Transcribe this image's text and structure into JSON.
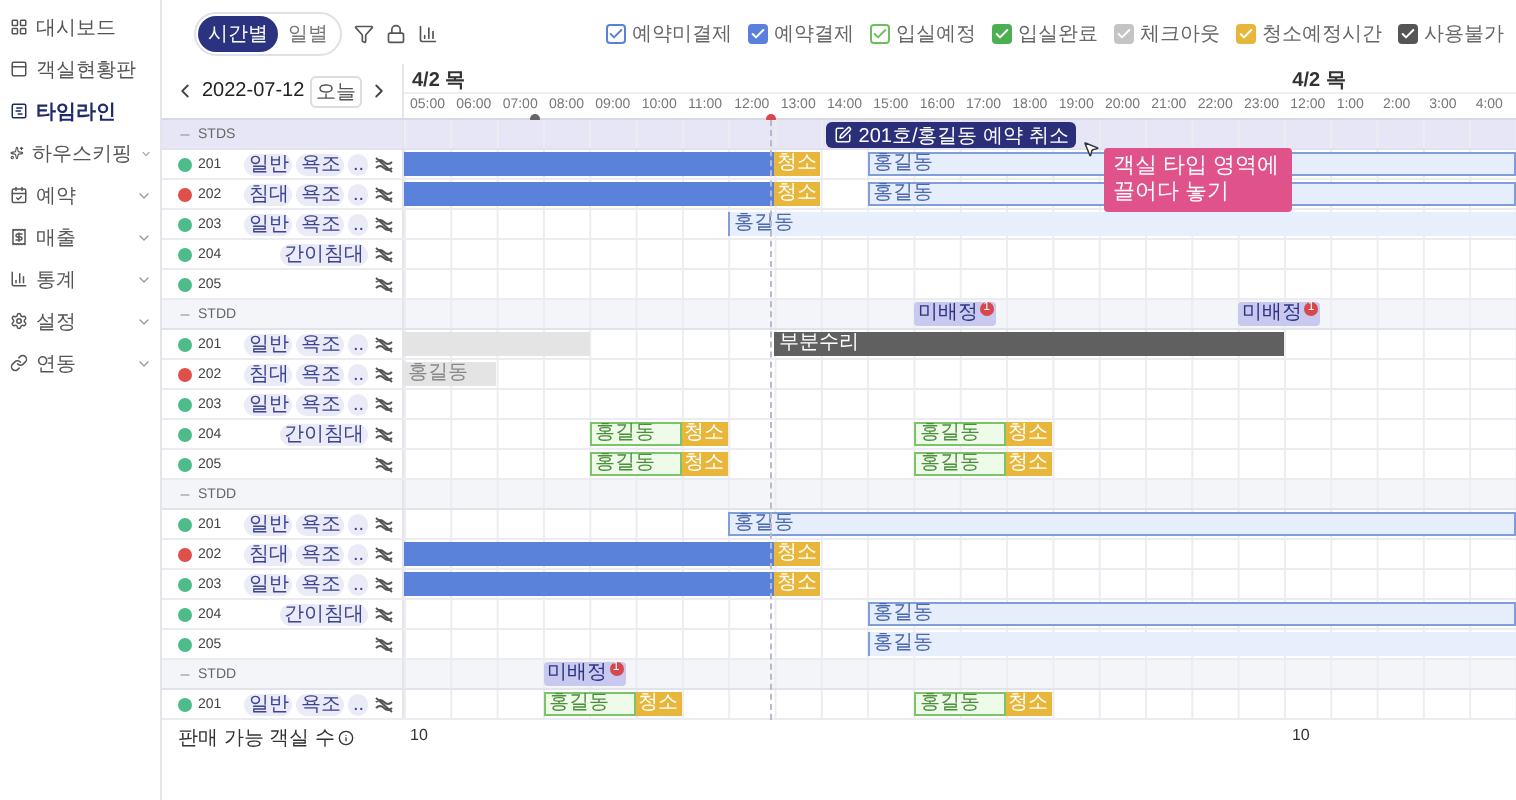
{
  "sidebar": {
    "items": [
      {
        "label": "대시보드",
        "selected": false,
        "expandable": false
      },
      {
        "label": "객실현황판",
        "selected": false,
        "expandable": false
      },
      {
        "label": "타임라인",
        "selected": true,
        "expandable": false
      },
      {
        "label": "하우스키핑",
        "selected": false,
        "expandable": true
      },
      {
        "label": "예약",
        "selected": false,
        "expandable": true
      },
      {
        "label": "매출",
        "selected": false,
        "expandable": true
      },
      {
        "label": "통계",
        "selected": false,
        "expandable": true
      },
      {
        "label": "설정",
        "selected": false,
        "expandable": true
      },
      {
        "label": "연동",
        "selected": false,
        "expandable": true
      }
    ]
  },
  "view_toggle": [
    {
      "label": "시간별",
      "selected": true
    },
    {
      "label": "일별",
      "selected": false
    }
  ],
  "legend": [
    {
      "label": "예약미결제",
      "color": "#5b7fdc",
      "kind": "outline",
      "checked": true
    },
    {
      "label": "예약결제",
      "color": "#5b7fdc",
      "kind": "solid",
      "checked": true
    },
    {
      "label": "입실예정",
      "color": "#6cbf5a",
      "kind": "outline",
      "checked": true
    },
    {
      "label": "입실완료",
      "color": "#4caf50",
      "kind": "solid",
      "checked": true
    },
    {
      "label": "체크아웃",
      "color": "#c4c4c4",
      "kind": "solid",
      "checked": true
    },
    {
      "label": "청소예정시간",
      "color": "#e8b63a",
      "kind": "solid",
      "checked": true
    },
    {
      "label": "사용불가",
      "color": "#555555",
      "kind": "solid",
      "checked": true
    }
  ],
  "date_nav": {
    "date": "2022-07-12",
    "today_button": "오늘"
  },
  "timeline": {
    "days": [
      "4/2 목",
      "4/2 목"
    ],
    "hours": [
      "05:00",
      "06:00",
      "07:00",
      "08:00",
      "09:00",
      "10:00",
      "11:00",
      "12:00",
      "13:00",
      "14:00",
      "15:00",
      "16:00",
      "17:00",
      "18:00",
      "19:00",
      "20:00",
      "21:00",
      "22:00",
      "23:00",
      "12:00",
      "1:00",
      "2:00",
      "3:00",
      "4:00"
    ]
  },
  "groups": [
    {
      "name": "STDS",
      "highlighted": true,
      "rooms": [
        {
          "number": "201",
          "color": "#4dbb8a",
          "tags": [
            "일반",
            "욕조",
            ".."
          ],
          "bars": [
            {
              "kind": "paid"
            },
            {
              "kind": "cleaning",
              "label": "청소"
            },
            {
              "kind": "unpaid",
              "label": "홍길동"
            }
          ]
        },
        {
          "number": "202",
          "color": "#e0504a",
          "tags": [
            "침대",
            "욕조",
            ".."
          ],
          "bars": [
            {
              "kind": "paid"
            },
            {
              "kind": "cleaning",
              "label": "청소"
            },
            {
              "kind": "unpaid",
              "label": "홍길동"
            }
          ]
        },
        {
          "number": "203",
          "color": "#4dbb8a",
          "tags": [
            "일반",
            "욕조",
            ".."
          ],
          "bars": [
            {
              "kind": "pending",
              "label": "홍길동"
            }
          ]
        },
        {
          "number": "204",
          "color": "#4dbb8a",
          "tags": [
            "간이침대"
          ]
        },
        {
          "number": "205",
          "color": "#4dbb8a"
        }
      ]
    },
    {
      "name": "STDD",
      "highlighted": false,
      "badges": [
        {
          "label": "미배정",
          "count": "1"
        },
        {
          "label": "미배정",
          "count": "1"
        }
      ],
      "rooms": [
        {
          "number": "201",
          "color": "#4dbb8a",
          "tags": [
            "일반",
            "욕조",
            ".."
          ],
          "bars": [
            {
              "kind": "checkout"
            },
            {
              "kind": "blocked",
              "label": "부분수리"
            }
          ]
        },
        {
          "number": "202",
          "color": "#e0504a",
          "tags": [
            "침대",
            "욕조",
            ".."
          ],
          "bars": [
            {
              "kind": "checkout",
              "label": "홍길동"
            }
          ]
        },
        {
          "number": "203",
          "color": "#4dbb8a",
          "tags": [
            "일반",
            "욕조",
            ".."
          ]
        },
        {
          "number": "204",
          "color": "#4dbb8a",
          "tags": [
            "간이침대"
          ],
          "bars": [
            {
              "kind": "stay",
              "label": "홍길동"
            },
            {
              "kind": "cleaning",
              "label": "청소"
            },
            {
              "kind": "stay",
              "label": "홍길동"
            },
            {
              "kind": "cleaning",
              "label": "청소"
            }
          ]
        },
        {
          "number": "205",
          "color": "#4dbb8a",
          "bars": [
            {
              "kind": "stay",
              "label": "홍길동"
            },
            {
              "kind": "cleaning",
              "label": "청소"
            },
            {
              "kind": "stay",
              "label": "홍길동"
            },
            {
              "kind": "cleaning",
              "label": "청소"
            }
          ]
        }
      ]
    },
    {
      "name": "STDD",
      "highlighted": false,
      "rooms": [
        {
          "number": "201",
          "color": "#4dbb8a",
          "tags": [
            "일반",
            "욕조",
            ".."
          ],
          "bars": [
            {
              "kind": "unpaid",
              "label": "홍길동"
            }
          ]
        },
        {
          "number": "202",
          "color": "#e0504a",
          "tags": [
            "침대",
            "욕조",
            ".."
          ],
          "bars": [
            {
              "kind": "paid"
            },
            {
              "kind": "cleaning",
              "label": "청소"
            }
          ]
        },
        {
          "number": "203",
          "color": "#4dbb8a",
          "tags": [
            "일반",
            "욕조",
            ".."
          ],
          "bars": [
            {
              "kind": "paid"
            },
            {
              "kind": "cleaning",
              "label": "청소"
            }
          ]
        },
        {
          "number": "204",
          "color": "#4dbb8a",
          "tags": [
            "간이침대"
          ],
          "bars": [
            {
              "kind": "unpaid",
              "label": "홍길동"
            }
          ]
        },
        {
          "number": "205",
          "color": "#4dbb8a",
          "bars": [
            {
              "kind": "pending",
              "label": "홍길동"
            }
          ]
        }
      ]
    },
    {
      "name": "STDD",
      "highlighted": false,
      "badges": [
        {
          "label": "미배정",
          "count": "1"
        }
      ],
      "rooms": [
        {
          "number": "201",
          "color": "#4dbb8a",
          "tags": [
            "일반",
            "욕조",
            ".."
          ],
          "bars": [
            {
              "kind": "stay",
              "label": "홍길동"
            },
            {
              "kind": "cleaning",
              "label": "청소"
            },
            {
              "kind": "stay",
              "label": "홍길동"
            },
            {
              "kind": "cleaning",
              "label": "청소"
            }
          ]
        }
      ]
    }
  ],
  "drag_tooltip": {
    "text": "201호/홍길동 예약 취소"
  },
  "callout": {
    "text": "객실 타입 영역에 끌어다 놓기"
  },
  "footer": {
    "label": "판매 가능 객실 수",
    "values": [
      "10",
      "10"
    ]
  }
}
